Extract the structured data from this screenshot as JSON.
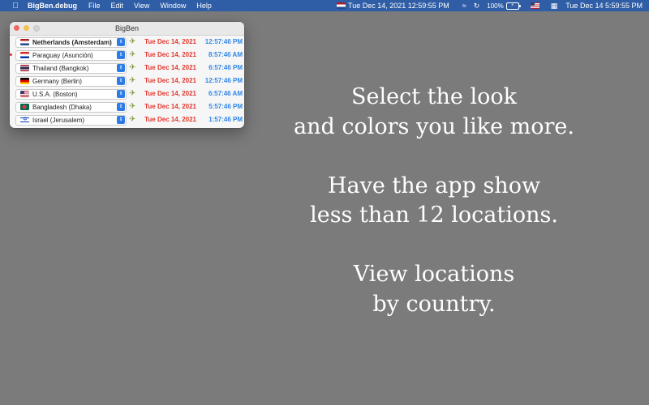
{
  "menubar": {
    "app_name": "BigBen.debug",
    "menus": [
      "File",
      "Edit",
      "View",
      "Window",
      "Help"
    ],
    "status_clock_flag": "nl",
    "status_clock": "Tue Dec 14, 2021 12:59:55 PM",
    "battery_percent": "100%",
    "input_flag": "us",
    "system_clock": "Tue Dec 14  5:59:55 PM"
  },
  "window": {
    "title": "BigBen",
    "rows": [
      {
        "flag": "nl",
        "location": "Netherlands (Amsterdam)",
        "date": "Tue Dec 14, 2021",
        "time": "12:57:46 PM",
        "bold": true,
        "marked": false
      },
      {
        "flag": "py",
        "location": "Paraguay (Asunción)",
        "date": "Tue Dec 14, 2021",
        "time": "8:57:46 AM",
        "bold": false,
        "marked": true
      },
      {
        "flag": "th",
        "location": "Thailand (Bangkok)",
        "date": "Tue Dec 14, 2021",
        "time": "6:57:46 PM",
        "bold": false,
        "marked": false
      },
      {
        "flag": "de",
        "location": "Germany (Berlin)",
        "date": "Tue Dec 14, 2021",
        "time": "12:57:46 PM",
        "bold": false,
        "marked": false
      },
      {
        "flag": "us",
        "location": "U.S.A. (Boston)",
        "date": "Tue Dec 14, 2021",
        "time": "6:57:46 AM",
        "bold": false,
        "marked": false
      },
      {
        "flag": "bd",
        "location": "Bangladesh (Dhaka)",
        "date": "Tue Dec 14, 2021",
        "time": "5:57:46 PM",
        "bold": false,
        "marked": false
      },
      {
        "flag": "il",
        "location": "Israel (Jerusalem)",
        "date": "Tue Dec 14, 2021",
        "time": "1:57:46 PM",
        "bold": false,
        "marked": false
      }
    ]
  },
  "promo": {
    "line1": "Select the look",
    "line2": "and colors you like more.",
    "line3": "Have the app show",
    "line4": "less than 12 locations.",
    "line5": "View locations",
    "line6": "by country."
  },
  "colors": {
    "desktop": "#7b7b7b",
    "menubar": "#2f5da6",
    "date_text": "#e3372e",
    "time_text": "#2f87e8",
    "stepper": "#2d7be5"
  }
}
